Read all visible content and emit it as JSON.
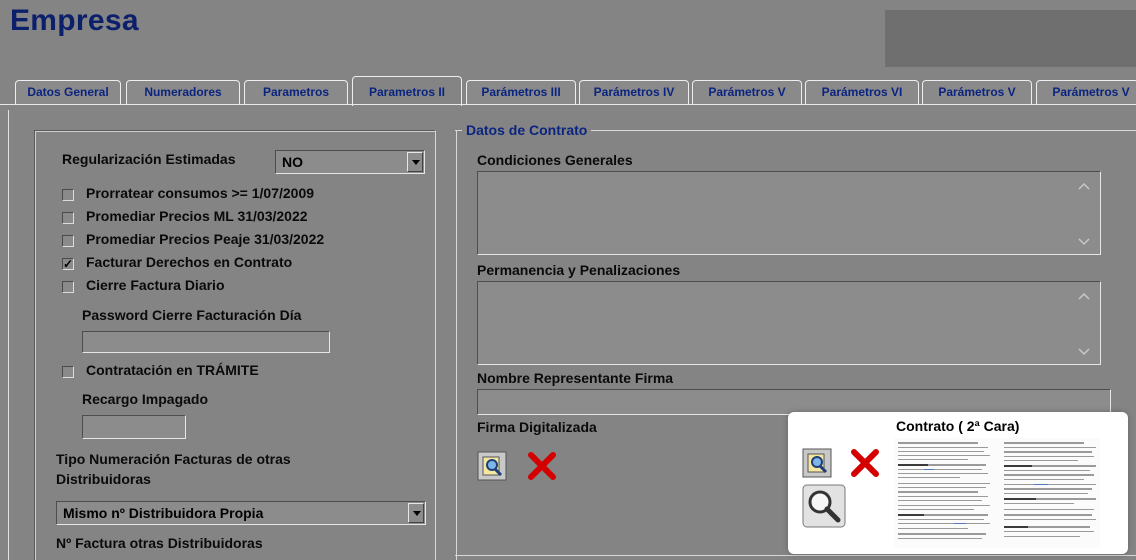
{
  "app": {
    "title": "Empresa"
  },
  "tabs": [
    {
      "label": "Datos General",
      "active": false
    },
    {
      "label": "Numeradores",
      "active": false
    },
    {
      "label": "Parametros",
      "active": false
    },
    {
      "label": "Parametros II",
      "active": true
    },
    {
      "label": "Parámetros III",
      "active": false
    },
    {
      "label": "Parámetros IV",
      "active": false
    },
    {
      "label": "Parámetros V",
      "active": false
    },
    {
      "label": "Parámetros VI",
      "active": false
    },
    {
      "label": "Parámetros V",
      "active": false
    },
    {
      "label": "Parámetros V",
      "active": false
    }
  ],
  "left": {
    "regularizacion_label": "Regularización  Estimadas",
    "regularizacion_value": "NO",
    "checkboxes": [
      {
        "label": "Prorratear consumos >= 1/07/2009",
        "checked": false
      },
      {
        "label": "Promediar Precios ML 31/03/2022",
        "checked": false
      },
      {
        "label": "Promediar Precios Peaje 31/03/2022",
        "checked": false
      },
      {
        "label": "Facturar Derechos en Contrato",
        "checked": true
      },
      {
        "label": "Cierre Factura Diario",
        "checked": false
      }
    ],
    "password_label": "Password Cierre Facturación Día",
    "password_value": "",
    "tramite_label": "Contratación en TRÁMITE",
    "tramite_checked": false,
    "recargo_label": "Recargo Impagado",
    "recargo_value": "",
    "tipo_label_1": "Tipo Numeración Facturas de otras",
    "tipo_label_2": "Distribuidoras",
    "tipo_value": "Mismo nº Distribuidora Propia",
    "nfactura_label": "Nº Factura otras Distribuidoras"
  },
  "contract": {
    "group_title": "Datos de Contrato",
    "condiciones_label": "Condiciones Generales",
    "condiciones_value": "",
    "permanencia_label": "Permanencia y Penalizaciones",
    "permanencia_value": "",
    "representante_label": "Nombre Representante Firma",
    "representante_value": "",
    "firma_label": "Firma Digitalizada"
  },
  "popup": {
    "title": "Contrato ( 2ª Cara)"
  },
  "colors": {
    "background": "#848484",
    "title": "#0b1f6b",
    "tab_text": "#0b2480",
    "group_title": "#0b2480",
    "delete_icon": "#d40000",
    "search_icon": "#2b6fb5"
  },
  "icons": {
    "browse": "search-document-icon",
    "delete": "red-x-icon",
    "zoom": "magnifier-icon"
  }
}
